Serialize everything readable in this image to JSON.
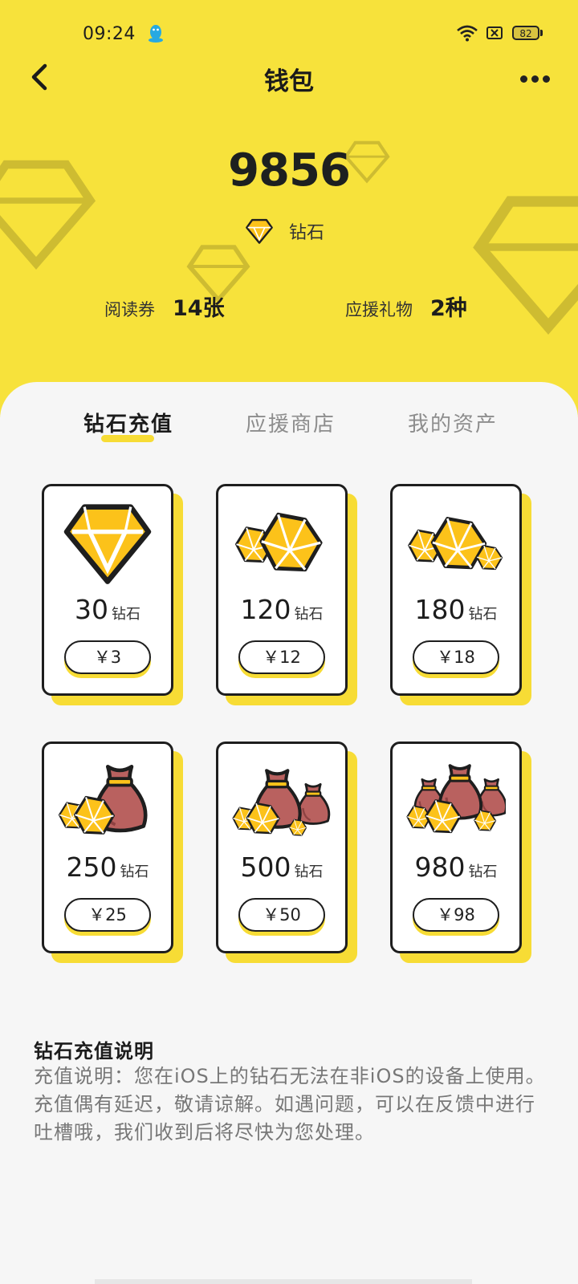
{
  "status_bar": {
    "time": "09:24",
    "battery": "82",
    "icons": [
      "qq-penguin-icon",
      "wifi-icon",
      "sim-off-icon",
      "battery-icon"
    ]
  },
  "nav": {
    "title": "钱包",
    "back_icon": "chevron-left-icon",
    "more_icon": "more-dots-icon"
  },
  "balance": {
    "amount": "9856",
    "unit_label": "钻石",
    "unit_icon": "diamond-icon"
  },
  "stats": [
    {
      "label": "阅读券",
      "value": "14张"
    },
    {
      "label": "应援礼物",
      "value": "2种"
    }
  ],
  "tabs": [
    {
      "label": "钻石充值",
      "active": true
    },
    {
      "label": "应援商店",
      "active": false
    },
    {
      "label": "我的资产",
      "active": false
    }
  ],
  "packages": [
    {
      "amount": "30",
      "unit": "钻石",
      "price": "￥3",
      "icon": "single-diamond-icon"
    },
    {
      "amount": "120",
      "unit": "钻石",
      "price": "￥12",
      "icon": "two-diamonds-icon"
    },
    {
      "amount": "180",
      "unit": "钻石",
      "price": "￥18",
      "icon": "three-diamonds-icon"
    },
    {
      "amount": "250",
      "unit": "钻石",
      "price": "￥25",
      "icon": "money-bag-diamonds-icon"
    },
    {
      "amount": "500",
      "unit": "钻石",
      "price": "￥50",
      "icon": "two-money-bags-icon"
    },
    {
      "amount": "980",
      "unit": "钻石",
      "price": "￥98",
      "icon": "three-money-bags-icon"
    }
  ],
  "description": {
    "title": "钻石充值说明",
    "body": "充值说明：您在iOS上的钻石无法在非iOS的设备上使用。充值偶有延迟，敬请谅解。如遇问题，可以在反馈中进行吐槽哦，我们收到后将尽快为您处理。"
  },
  "colors": {
    "header_yellow": "#f7e23b",
    "accent_yellow": "#f7dc35",
    "gem_yellow": "#fcc21a",
    "bag_red": "#b9615f",
    "outline": "#1e1e1e"
  }
}
